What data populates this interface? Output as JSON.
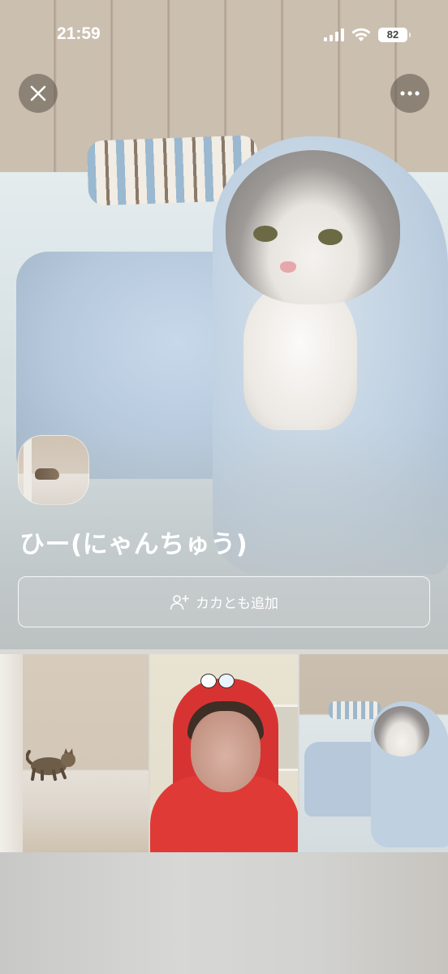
{
  "status_bar": {
    "time": "21:59",
    "battery": "82"
  },
  "header": {
    "close_icon": "close-icon",
    "more_icon": "more-icon"
  },
  "profile": {
    "name": "ひー(にゃんちゅう)",
    "add_friend_label": "カカとも追加",
    "add_friend_icon": "person-add-icon"
  },
  "photos": [
    {
      "subject": "cat-in-hallway"
    },
    {
      "subject": "person-in-red-hoodie"
    },
    {
      "subject": "cat-under-blanket"
    }
  ],
  "colors": {
    "hoodie_red": "#e03a36",
    "blanket_blue": "#bfd0e0"
  }
}
